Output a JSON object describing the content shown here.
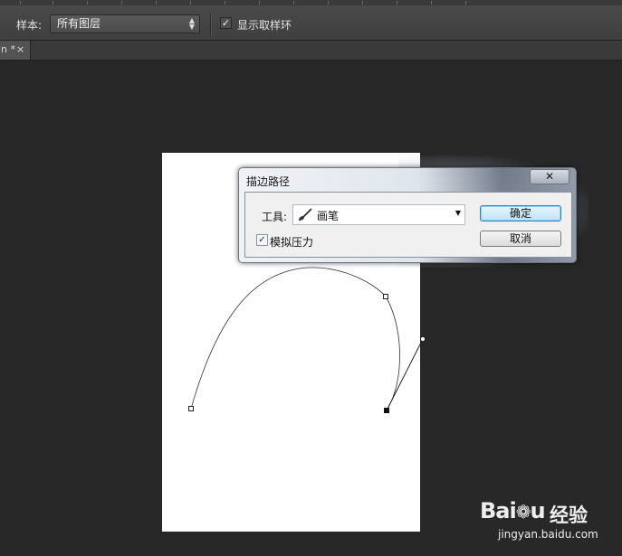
{
  "options_bar": {
    "sample_label": "样本:",
    "sample_value": "所有图层",
    "show_sampling_ring_label": "显示取样环",
    "show_sampling_ring_checked": true
  },
  "document_tab": {
    "name": "n *",
    "close": "×"
  },
  "dialog": {
    "title": "描边路径",
    "close": "✕",
    "tool_label": "工具:",
    "tool_value": "画笔",
    "simulate_pressure_label": "模拟压力",
    "simulate_pressure_checked": true,
    "ok_label": "确定",
    "cancel_label": "取消"
  },
  "watermark": {
    "logo_left": "Bai",
    "logo_right": "u",
    "brand": "经验",
    "url": "jingyan.baidu.com"
  },
  "icons": [
    "sample-dropdown-arrows-icon",
    "checkbox-check-icon",
    "tab-close-icon",
    "dialog-close-icon",
    "brush-icon",
    "dropdown-arrow-icon",
    "baidu-paw-icon"
  ],
  "colors": {
    "workspace": "#282828",
    "options_bar": "#454545",
    "canvas": "#ffffff",
    "ok_button_border": "#3c7fb1"
  }
}
